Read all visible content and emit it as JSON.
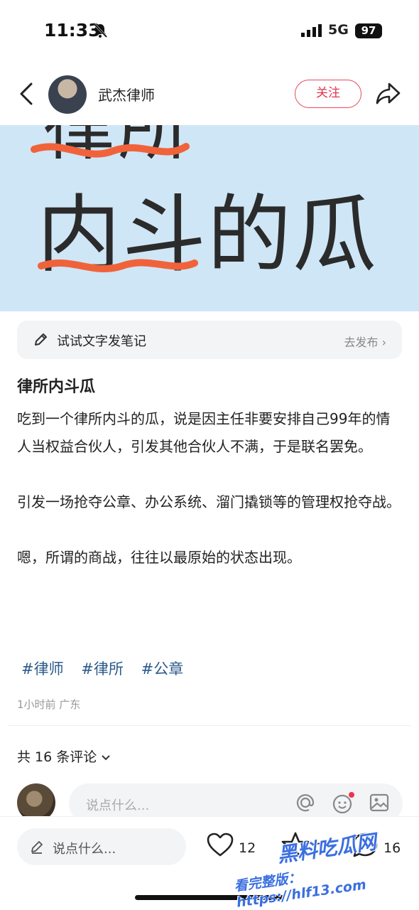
{
  "status_bar": {
    "time": "11:33",
    "network": "5G",
    "battery": "97"
  },
  "header": {
    "author": "武杰律师",
    "follow_label": "关注"
  },
  "cover": {
    "partial_text": "律所",
    "big_text": "内斗的瓜",
    "accent_color": "#f0633a",
    "bg_color": "#cfe6f6"
  },
  "try_note": {
    "label": "试试文字发笔记",
    "action": "去发布 ›"
  },
  "post": {
    "title": "律所内斗瓜",
    "paragraphs": [
      "吃到一个律所内斗的瓜，说是因主任非要安排自己99年的情人当权益合伙人，引发其他合伙人不满，于是联名罢免。",
      "引发一场抢夺公章、办公系统、溜门撬锁等的管理权抢夺战。",
      "嗯，所谓的商战，往往以最原始的状态出现。"
    ],
    "tags": [
      "#律师",
      "#律所",
      "#公章"
    ],
    "meta": "1小时前 广东"
  },
  "comments": {
    "count_label": "共 16 条评论",
    "input_placeholder": "说点什么..."
  },
  "bottom_bar": {
    "input_placeholder": "说点什么...",
    "likes": "12",
    "collects": "1",
    "comments": "16"
  },
  "watermark": {
    "line1": "黑料吃瓜网",
    "line2": "看完整版：https://hlf13.com"
  }
}
